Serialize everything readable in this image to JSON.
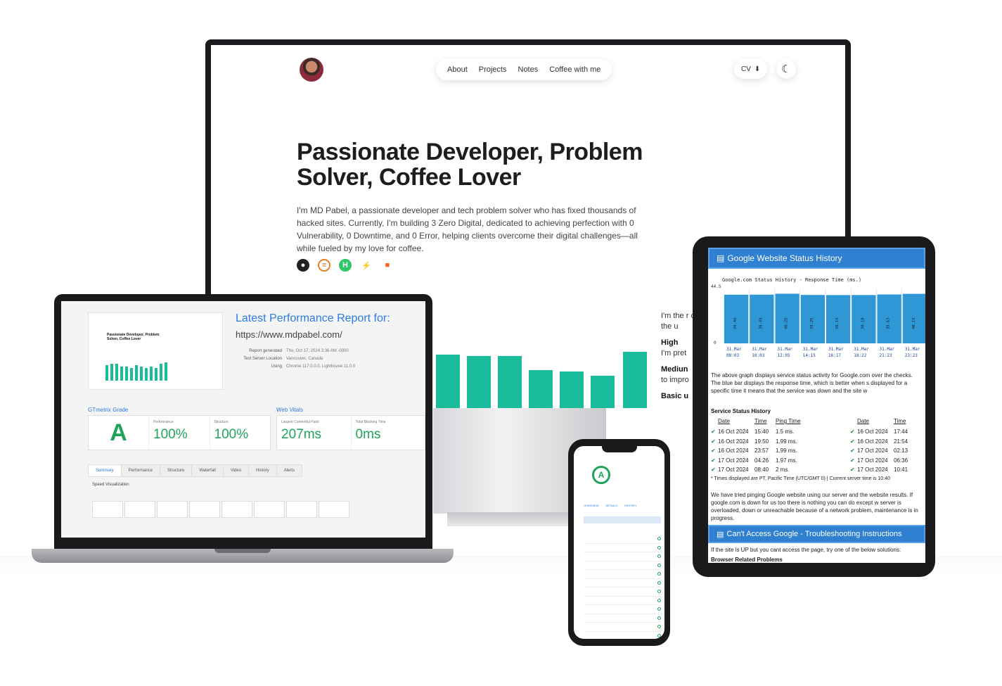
{
  "monitor": {
    "nav": [
      "About",
      "Projects",
      "Notes",
      "Coffee with me"
    ],
    "cv_label": "CV",
    "hero_title": "Passionate Developer, Problem Solver, Coffee Lover",
    "hero_text": "I'm MD Pabel, a passionate developer and tech problem solver who has fixed thousands of hacked sites. Currently, I'm building 3 Zero Digital, dedicated to achieving perfection with 0 Vulnerability, 0 Downtime, and 0 Error, helping clients overcome their digital challenges—all while fueled by my love for coffee.",
    "side_intro": "I'm the r of the u",
    "side_high": "High",
    "side_high_text": "I'm pret",
    "side_medium": "Mediun",
    "side_medium_text": "to impro",
    "side_basic": "Basic u",
    "accent_color": "#1abc9c"
  },
  "laptop": {
    "report_title": "Latest Performance Report for:",
    "report_url": "https://www.mdpabel.com/",
    "meta": [
      {
        "k": "Report generated",
        "v": "Thu, Oct 17, 2024 3:36 AM -0000"
      },
      {
        "k": "Test Server Location",
        "v": "Vancouver, Canada"
      },
      {
        "k": "Using",
        "v": "Chrome 117.0.0.0, Lighthouse 11.0.0"
      }
    ],
    "thumb_title": "Passionate Developer, Problem Solver, Coffee Lover",
    "gtmetrix_label": "GTmetrix Grade",
    "web_vitals_label": "Web Vitals",
    "grade": "A",
    "performance_label": "Performance",
    "performance": "100%",
    "structure_label": "Structure",
    "structure": "100%",
    "lcp_label": "Largest Contentful Paint",
    "lcp": "207ms",
    "tbt_label": "Total Blocking Time",
    "tbt": "0ms",
    "tabs": [
      "Summary",
      "Performance",
      "Structure",
      "Waterfall",
      "Video",
      "History",
      "Alerts"
    ],
    "speed_label": "Speed Visualization"
  },
  "tablet": {
    "header": "Google Website Status History",
    "chart_title": "Google.com Status History - Response Time (ms.)",
    "y_top": "44.5",
    "y_zero": "0",
    "para1": "The above graph displays service status activity for Google.com over the checks. The blue bar displays the response time, which is better when s displayed for a specific time it means that the service was down and the site w",
    "history_title": "Service Status History",
    "col_date": "Date",
    "col_time": "Time",
    "col_ping": "Ping Time",
    "rows_left": [
      {
        "date": "16 Oct 2024",
        "time": "15:40",
        "ping": "1.5 ms."
      },
      {
        "date": "16 Oct 2024",
        "time": "19:50",
        "ping": "1.99 ms."
      },
      {
        "date": "16 Oct 2024",
        "time": "23:57",
        "ping": "1.99 ms."
      },
      {
        "date": "17 Oct 2024",
        "time": "04:26",
        "ping": "1.97 ms."
      },
      {
        "date": "17 Oct 2024",
        "time": "08:40",
        "ping": "2 ms."
      }
    ],
    "rows_right": [
      {
        "date": "16 Oct 2024",
        "time": "17:44"
      },
      {
        "date": "16 Oct 2024",
        "time": "21:54"
      },
      {
        "date": "17 Oct 2024",
        "time": "02:13"
      },
      {
        "date": "17 Oct 2024",
        "time": "06:36"
      },
      {
        "date": "17 Oct 2024",
        "time": "10:41"
      }
    ],
    "footnote": "* Times displayed are PT, Pacific Time (UTC/GMT 0) | Current server time is 10:40",
    "para2": "We have tried pinging Google website using our server and the website results. If google.com is down for us too there is nothing you can do except w server is overloaded, down or unreachable because of a network problem, maintenance is in progress.",
    "header2": "Can't Access Google - Troubleshooting Instructions",
    "para3": "If the site is UP but you cant access the page, try one of the below solutions:",
    "subhead": "Browser Related Problems",
    "chart_color": "#2f97d6"
  },
  "phone": {
    "grade": "A",
    "tabs": [
      "OVERVIEW",
      "DETAILS",
      "HISTORY"
    ]
  },
  "chart_data": {
    "type": "bar",
    "title": "Google.com Status History - Response Time (ms.)",
    "categories": [
      "31.Mar 08:03",
      "31.Mar 10:03",
      "31.Mar 12:05",
      "31.Mar 14:15",
      "31.Mar 16:17",
      "31.Mar 18:22",
      "31.Mar 21:23",
      "31.Mar 23:23"
    ],
    "values": [
      39.46,
      39.49,
      40.25,
      39.25,
      39.15,
      39.18,
      39.63,
      40.15
    ],
    "ylim": [
      0,
      44.5
    ],
    "grid": true
  }
}
